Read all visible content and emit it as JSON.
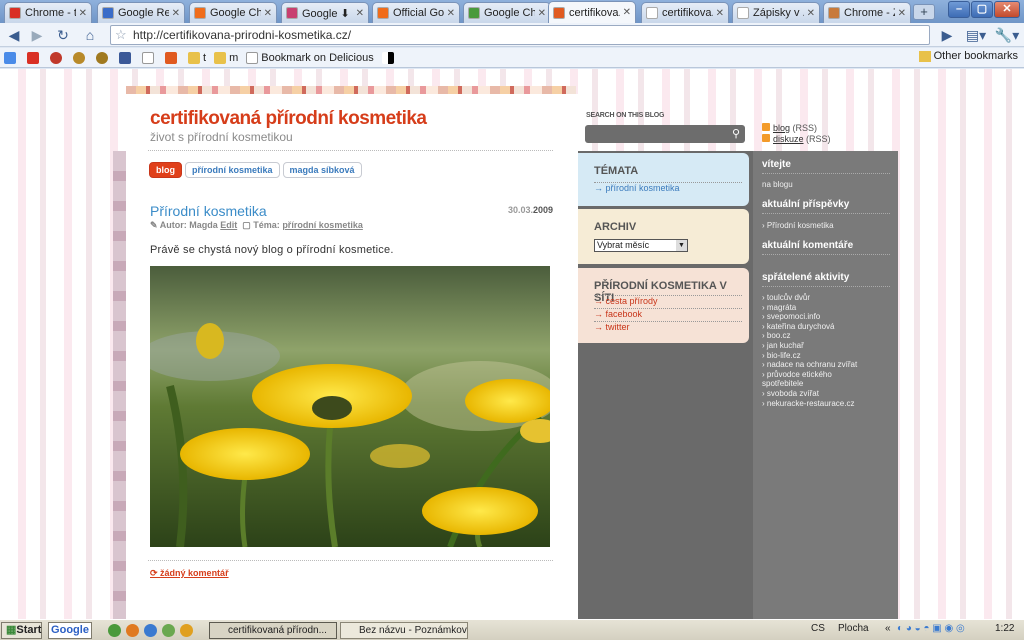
{
  "browser": {
    "tabs": [
      {
        "title": "Chrome - t...",
        "color": "#d93025"
      },
      {
        "title": "Google Re...",
        "color": "#3a6cc8"
      },
      {
        "title": "Google Ch...",
        "color": "#f06c1a"
      },
      {
        "title": "Google ⬇",
        "color": "#c84070"
      },
      {
        "title": "Official Go...",
        "color": "#f06c1a"
      },
      {
        "title": "Google Chr...",
        "color": "#4a9a3c"
      },
      {
        "title": "certifikova...",
        "color": "#e05a20"
      },
      {
        "title": "certifikova...",
        "color": "#ffffff"
      },
      {
        "title": "Zápisky v ...",
        "color": "#ffffff"
      },
      {
        "title": "Chrome - Z...",
        "color": "#c87a3a"
      }
    ],
    "address": "http://certifikovana-prirodni-kosmetika.cz/",
    "bookmarks": [
      "t",
      "m",
      "Bookmark on Delicious"
    ],
    "other_bookmarks": "Other bookmarks"
  },
  "page": {
    "site_title": "certifikovaná přírodní kosmetika",
    "site_subtitle": "život s přírodní kosmetikou",
    "nav_tabs": [
      "blog",
      "přírodní kosmetika",
      "magda síbková"
    ],
    "post": {
      "title": "Přírodní kosmetika",
      "date_prefix": "30.03.",
      "date_year": "2009",
      "author_label": "Autor: Magda",
      "edit_label": "Edit",
      "topic_label": "Téma:",
      "topic_link": "přírodní kosmetika",
      "text": "Právě se chystá nový blog o přírodní kosmetice.",
      "comments": "žádný komentář"
    },
    "search": {
      "label": "SEARCH ON THIS BLOG"
    },
    "rss": [
      {
        "link": "blog",
        "suffix": "(RSS)"
      },
      {
        "link": "diskuze",
        "suffix": "(RSS)"
      }
    ],
    "boxes": {
      "temata": {
        "title": "TÉMATA",
        "items": [
          "→ přírodní kosmetika"
        ],
        "color": "#d6eaf5"
      },
      "archiv": {
        "title": "ARCHIV",
        "select": "Vybrat měsíc",
        "color": "#f6ecd6"
      },
      "site": {
        "title": "PŘÍRODNÍ KOSMETIKA V SÍTI",
        "items": [
          "→ cesta přírody",
          "→ facebook",
          "→ twitter"
        ],
        "color": "#f6e2d6"
      }
    },
    "right": {
      "welcome_title": "vítejte",
      "welcome_text": "na blogu",
      "recent_title": "aktuální příspěvky",
      "recent_item": "› Přírodní kosmetika",
      "comments_title": "aktuální komentáře",
      "friends_title": "spřátelené aktivity",
      "friends": [
        "› toulcův dvůr",
        "› magráta",
        "› svepomoci.info",
        "› kateřina durychová",
        "› boo.cz",
        "› jan kuchař",
        "› bio-life.cz",
        "› nadace na ochranu zvířat",
        "› průvodce etického",
        "   spotřebitele",
        "› svoboda zvířat",
        "› nekuracke-restaurace.cz"
      ]
    }
  },
  "taskbar": {
    "start": "Start",
    "google": "Google",
    "items": [
      "certifikovaná přírodn...",
      "Bez názvu - Poznámkový ..."
    ],
    "lang": "CS",
    "desktop": "Plocha",
    "time": "1:22"
  }
}
